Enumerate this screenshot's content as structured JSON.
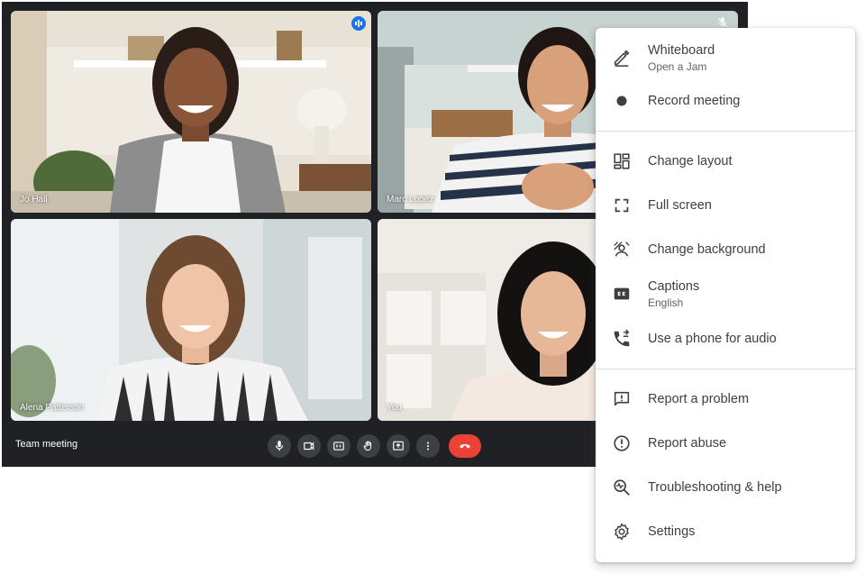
{
  "meeting": {
    "title": "Team meeting",
    "participants": [
      {
        "name": "Jo Hall",
        "speaking": true
      },
      {
        "name": "Marc Lopez",
        "muted": true
      },
      {
        "name": "Alena Patterson"
      },
      {
        "name": "You"
      }
    ]
  },
  "controls": [
    {
      "name": "microphone-button",
      "icon": "mic-icon"
    },
    {
      "name": "camera-button",
      "icon": "videocam-icon"
    },
    {
      "name": "captions-button",
      "icon": "closed-caption-icon"
    },
    {
      "name": "raise-hand-button",
      "icon": "hand-icon"
    },
    {
      "name": "present-button",
      "icon": "present-screen-icon"
    },
    {
      "name": "more-options-button",
      "icon": "more-vert-icon"
    },
    {
      "name": "leave-call-button",
      "icon": "call-end-icon"
    }
  ],
  "menu": {
    "whiteboard": {
      "label": "Whiteboard",
      "sub": "Open a Jam"
    },
    "record": {
      "label": "Record meeting"
    },
    "change_layout": {
      "label": "Change layout"
    },
    "full_screen": {
      "label": "Full screen"
    },
    "change_background": {
      "label": "Change background"
    },
    "captions": {
      "label": "Captions",
      "sub": "English"
    },
    "phone_audio": {
      "label": "Use a phone for audio"
    },
    "report_problem": {
      "label": "Report a problem"
    },
    "report_abuse": {
      "label": "Report abuse"
    },
    "troubleshooting": {
      "label": "Troubleshooting & help"
    },
    "settings": {
      "label": "Settings"
    }
  },
  "colors": {
    "background": "#202124",
    "control": "#3c4043",
    "end_call": "#ea4335",
    "speaking": "#1a73e8",
    "menu_text": "#3c4043"
  }
}
